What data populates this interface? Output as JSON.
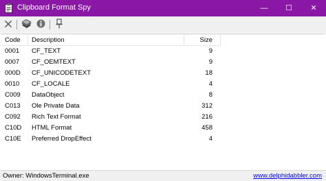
{
  "window": {
    "title": "Clipboard Format Spy",
    "title_bar_color": "#8a17a6",
    "controls": {
      "minimize": "—",
      "maximize": "☐",
      "close": "✕"
    }
  },
  "toolbar": {
    "buttons": [
      {
        "icon": "close-x-icon"
      },
      {
        "icon": "clipboard-stack-icon"
      },
      {
        "icon": "info-icon"
      },
      {
        "icon": "pin-icon"
      }
    ]
  },
  "list": {
    "columns": {
      "code": "Code",
      "description": "Description",
      "size": "Size"
    },
    "rows": [
      {
        "code": "0001",
        "description": "CF_TEXT",
        "size": "9"
      },
      {
        "code": "0007",
        "description": "CF_OEMTEXT",
        "size": "9"
      },
      {
        "code": "000D",
        "description": "CF_UNICODETEXT",
        "size": "18"
      },
      {
        "code": "0010",
        "description": "CF_LOCALE",
        "size": "4"
      },
      {
        "code": "C009",
        "description": "DataObject",
        "size": "8"
      },
      {
        "code": "C013",
        "description": "Ole Private Data",
        "size": "312"
      },
      {
        "code": "C092",
        "description": "Rich Text Format",
        "size": "216"
      },
      {
        "code": "C10D",
        "description": "HTML Format",
        "size": "458"
      },
      {
        "code": "C10E",
        "description": "Preferred DropEffect",
        "size": "4"
      }
    ]
  },
  "status": {
    "owner": "Owner: WindowsTerminal.exe",
    "link": "www.delphidabbler.com"
  }
}
